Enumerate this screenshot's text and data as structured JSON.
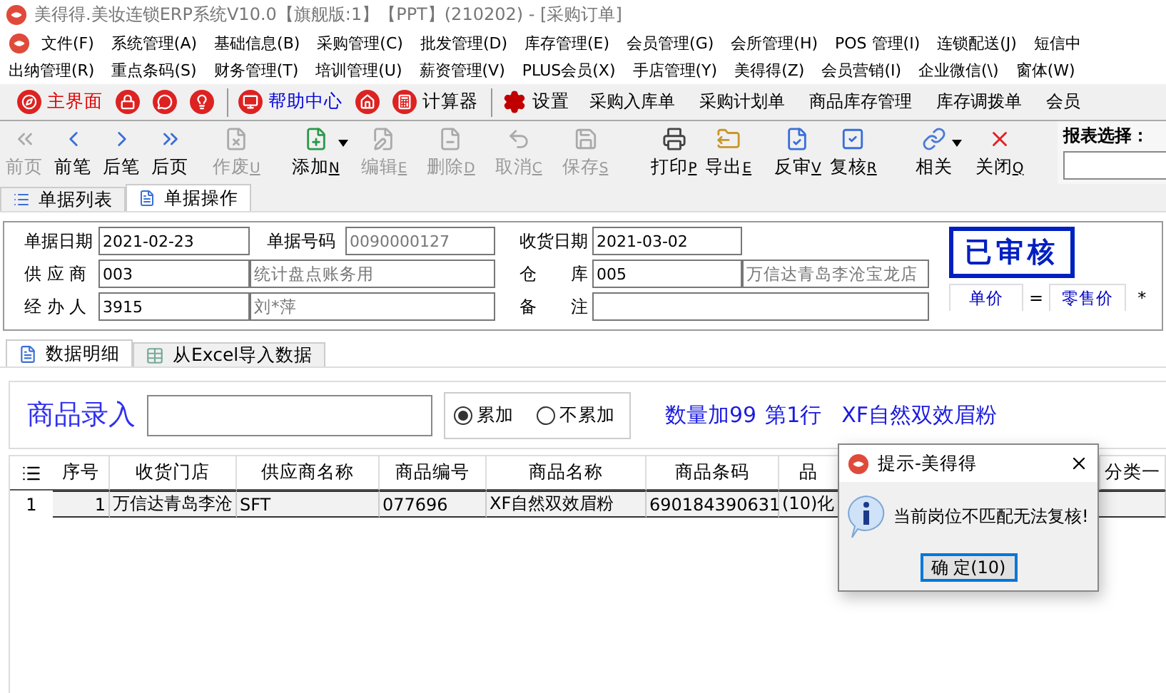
{
  "window": {
    "title": "美得得.美妆连锁ERP系统V10.0【旗舰版:1】【PPT】(210202) - [采购订单]"
  },
  "menu_rows": [
    [
      "文件(F)",
      "系统管理(A)",
      "基础信息(B)",
      "采购管理(C)",
      "批发管理(D)",
      "库存管理(E)",
      "会员管理(G)",
      "会所管理(H)",
      "POS 管理(I)",
      "连锁配送(J)",
      "短信中"
    ],
    [
      "出纳管理(R)",
      "重点条码(S)",
      "财务管理(T)",
      "培训管理(U)",
      "薪资管理(V)",
      "PLUS会员(X)",
      "手店管理(Y)",
      "美得得(Z)",
      "会员营销(I)",
      "企业微信(\\)",
      "窗体(W)"
    ]
  ],
  "quick_bar": [
    {
      "kind": "compass",
      "label": "主界面",
      "color": "#e00000"
    },
    {
      "kind": "lock"
    },
    {
      "kind": "chat"
    },
    {
      "kind": "bulb"
    },
    {
      "kind": "sep"
    },
    {
      "kind": "monitor",
      "label": "帮助中心",
      "color": "#0000e0"
    },
    {
      "kind": "home"
    },
    {
      "kind": "calc",
      "label": "计算器",
      "color": "#000000"
    },
    {
      "kind": "sep"
    },
    {
      "kind": "gear",
      "label": "设置",
      "color": "#000000"
    },
    {
      "kind": "text",
      "label": "采购入库单",
      "color": "#000000"
    },
    {
      "kind": "text",
      "label": "采购计划单",
      "color": "#000000"
    },
    {
      "kind": "text",
      "label": "商品库存管理",
      "color": "#000000"
    },
    {
      "kind": "text",
      "label": "库存调拨单",
      "color": "#000000"
    },
    {
      "kind": "text",
      "label": "会员",
      "color": "#000000"
    }
  ],
  "toolbar": [
    {
      "label": "前页",
      "disabled": true
    },
    {
      "label": "前笔",
      "disabled": false
    },
    {
      "label": "后笔",
      "disabled": false
    },
    {
      "label": "后页",
      "disabled": false
    },
    {
      "label": "作废",
      "shortcut": "U",
      "disabled": true
    },
    {
      "label": "添加",
      "shortcut": "N",
      "disabled": false,
      "dropdown": true
    },
    {
      "label": "编辑",
      "shortcut": "E",
      "disabled": true
    },
    {
      "label": "删除",
      "shortcut": "D",
      "disabled": true
    },
    {
      "label": "取消",
      "shortcut": "C",
      "disabled": true
    },
    {
      "label": "保存",
      "shortcut": "S",
      "disabled": true
    },
    {
      "label": "打印",
      "shortcut": "P",
      "disabled": false
    },
    {
      "label": "导出",
      "shortcut": "E",
      "disabled": false
    },
    {
      "label": "反审",
      "shortcut": "V",
      "disabled": false
    },
    {
      "label": "复核",
      "shortcut": "R",
      "disabled": false
    },
    {
      "label": "相关",
      "disabled": false,
      "dropdown": true
    },
    {
      "label": "关闭",
      "shortcut": "Q",
      "disabled": false
    }
  ],
  "report_select": {
    "label": "报表选择："
  },
  "page_tabs": [
    {
      "label": "单据列表",
      "selected": false
    },
    {
      "label": "单据操作",
      "selected": true
    }
  ],
  "form": {
    "rows": [
      [
        {
          "label": "单据日期",
          "value": "2021-02-23"
        },
        {
          "label": "单据号码",
          "value": "0090000127"
        },
        {
          "label": "收货日期",
          "value": "2021-03-02"
        }
      ],
      [
        {
          "label": "供 应 商",
          "value": "003",
          "detail": "统计盘点账务用"
        },
        {
          "label": "仓　　库",
          "value": "005",
          "detail": "万信达青岛李沧宝龙店"
        }
      ],
      [
        {
          "label": "经 办 人",
          "value": "3915",
          "detail": "刘*萍"
        },
        {
          "label": "备　　注"
        }
      ]
    ],
    "stamp": "已审核",
    "price_from": "单价",
    "equals": "=",
    "price_to": "零售价",
    "mark": "*"
  },
  "detail_tabs": [
    {
      "label": "数据明细",
      "selected": true
    },
    {
      "label": "从Excel导入数据",
      "selected": false
    }
  ],
  "entry": {
    "title": "商品录入",
    "modes": [
      {
        "label": "累加",
        "selected": true
      },
      {
        "label": "不累加",
        "selected": false
      }
    ],
    "info": [
      "数量加99",
      "第1行",
      "XF自然双效眉粉"
    ]
  },
  "table": {
    "columns": [
      "序号",
      "收货门店",
      "供应商名称",
      "商品编号",
      "商品名称",
      "商品条码",
      "品",
      "分类一"
    ],
    "rows": [
      {
        "row_number": "1",
        "cells": [
          "1",
          "万信达青岛李沧",
          "SFT",
          "077696",
          "XF自然双效眉粉",
          "690184390631",
          "(10)化"
        ]
      }
    ]
  },
  "dialog": {
    "title": "提示-美得得",
    "message": "当前岗位不匹配无法复核!",
    "button": "确 定(10)"
  }
}
